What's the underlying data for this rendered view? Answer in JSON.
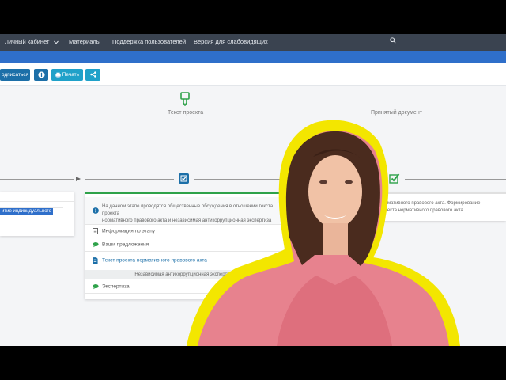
{
  "nav": {
    "items": [
      "Личный кабинет",
      "Материалы",
      "Поддержка пользователей",
      "Версия для слабовидящих"
    ]
  },
  "toolbar": {
    "subscribe": "одписаться",
    "print": "Печать"
  },
  "steps": {
    "project_text": "Текст проекта",
    "accepted": "Принятый документ"
  },
  "left_card": {
    "highlight": "итие индивидуального"
  },
  "center_card": {
    "info_text_1": "На данном этапе проводятся общественные обсуждения в отношении текста проекта",
    "info_text_2": "нормативного правового акта и независимая антикоррупционная экспертиза",
    "stage_info": "Информация по этапу",
    "your_proposals": "Ваши предложения",
    "doc_link": "Текст проекта нормативного правового акта",
    "independent": "Независимая антикоррупционная экспертиза",
    "expertise": "Экспертиза"
  },
  "right_card": {
    "line1": "нормативного правового акта. Формирование",
    "line2": "проекта нормативного правового акта."
  },
  "colors": {
    "nav_bg": "#3a4350",
    "brand_blue": "#2f6fca",
    "button": "#1fa1c9",
    "accent_green": "#2ea24a",
    "person_outline": "#f5e300"
  },
  "icons": [
    "chevron-down-icon",
    "search-icon",
    "info-icon",
    "print-icon",
    "share-icon",
    "edit-icon",
    "check-icon",
    "document-icon",
    "chat-icon"
  ]
}
